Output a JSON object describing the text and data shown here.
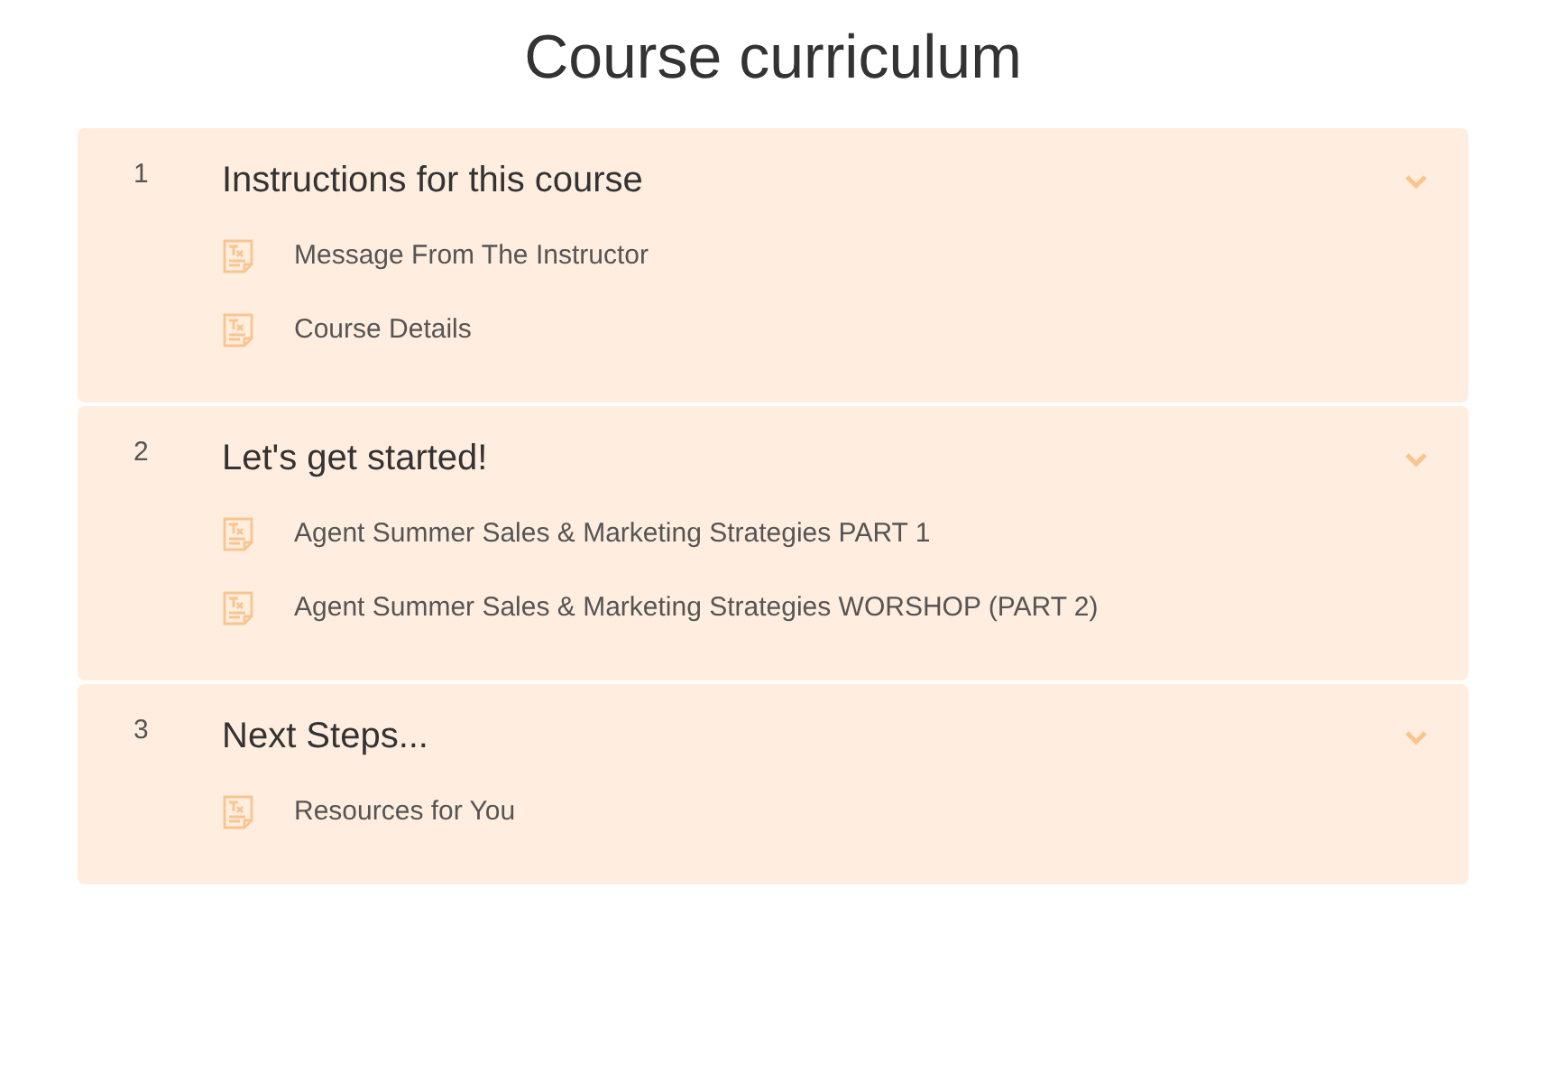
{
  "title": "Course curriculum",
  "sections": [
    {
      "number": "1",
      "title": "Instructions for this course",
      "expanded": true,
      "lessons": [
        {
          "title": "Message From The Instructor"
        },
        {
          "title": "Course Details"
        }
      ]
    },
    {
      "number": "2",
      "title": "Let's get started!",
      "expanded": true,
      "lessons": [
        {
          "title": "Agent Summer Sales & Marketing Strategies PART 1"
        },
        {
          "title": "Agent Summer Sales & Marketing Strategies WORSHOP (PART 2)"
        }
      ]
    },
    {
      "number": "3",
      "title": "Next Steps...",
      "expanded": true,
      "lessons": [
        {
          "title": "Resources for You"
        }
      ]
    }
  ]
}
